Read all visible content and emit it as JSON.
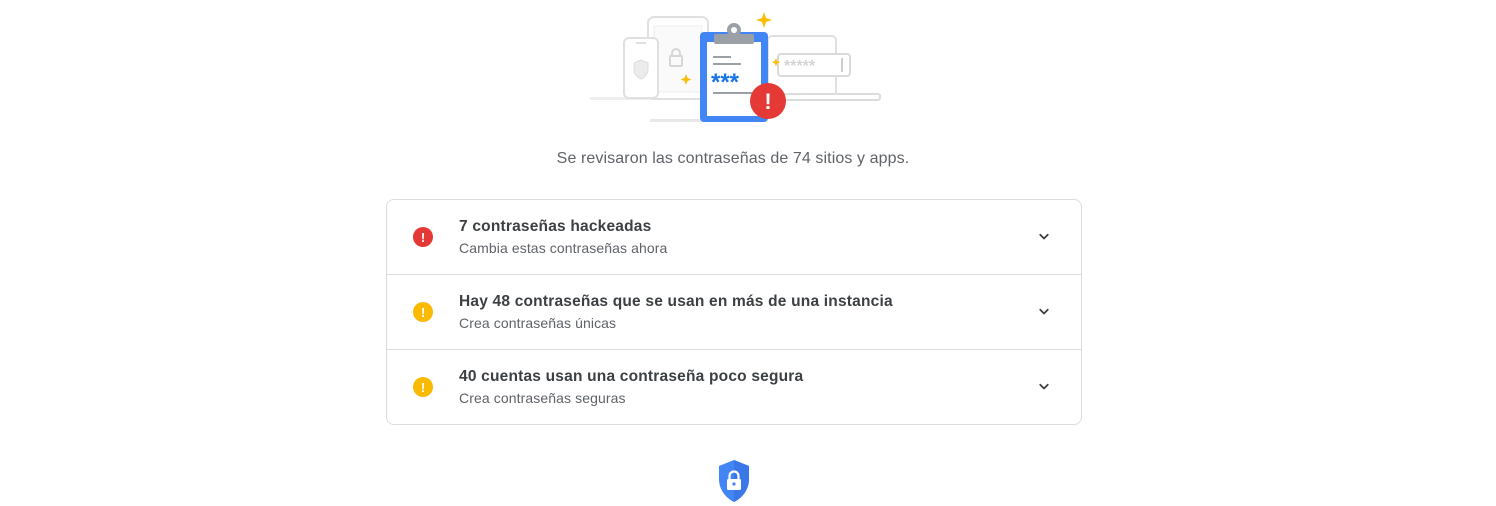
{
  "summary_text": "Se revisaron las contraseñas de 74 sitios y apps.",
  "illustration": {
    "password_mask": "***",
    "field_mask": "*****",
    "alert_glyph": "!"
  },
  "issues": [
    {
      "title": "7 contraseñas hackeadas",
      "subtitle": "Cambia estas contraseñas ahora",
      "icon_glyph": "!",
      "severity_color": "#e53935",
      "icon": "error-icon"
    },
    {
      "title": "Hay 48 contraseñas que se usan en más de una instancia",
      "subtitle": "Crea contraseñas únicas",
      "icon_glyph": "!",
      "severity_color": "#f9ba00",
      "icon": "warning-icon"
    },
    {
      "title": "40 cuentas usan una contraseña poco segura",
      "subtitle": "Crea contraseñas seguras",
      "icon_glyph": "!",
      "severity_color": "#f9ba00",
      "icon": "warning-icon"
    }
  ],
  "colors": {
    "accent_blue": "#4285f4",
    "error_red": "#e53935",
    "warning_yellow": "#f9ba00",
    "divider": "#dadce0"
  },
  "icons": {
    "expand": "chevron-down-icon",
    "footer": "shield-lock-icon",
    "hero": "password-checkup-illustration"
  }
}
